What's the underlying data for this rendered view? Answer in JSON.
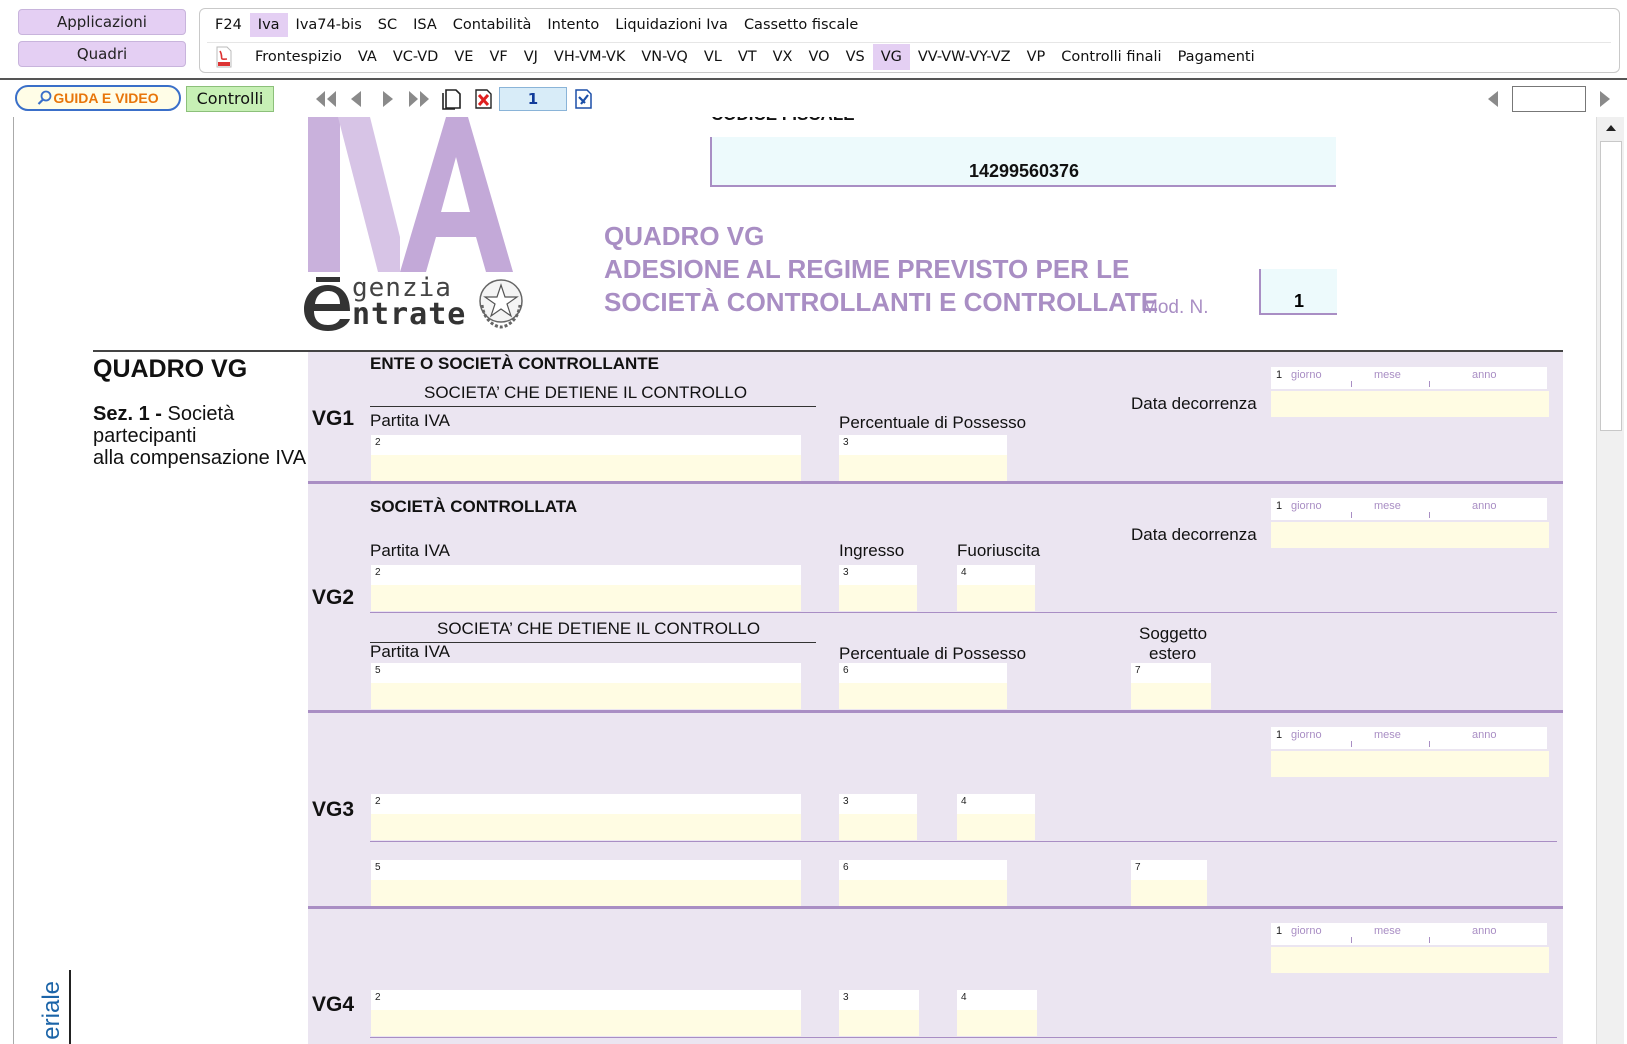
{
  "left_nav": {
    "applicazioni": "Applicazioni",
    "quadri": "Quadri"
  },
  "menu_row1": [
    "F24",
    "Iva",
    "Iva74-bis",
    "SC",
    "ISA",
    "Contabilità",
    "Intento",
    "Liquidazioni Iva",
    "Cassetto fiscale"
  ],
  "menu_row1_active": "Iva",
  "menu_row2": [
    "Frontespizio",
    "VA",
    "VC-VD",
    "VE",
    "VF",
    "VJ",
    "VH-VM-VK",
    "VN-VQ",
    "VL",
    "VT",
    "VX",
    "VO",
    "VS",
    "VG",
    "VV-VW-VY-VZ",
    "VP",
    "Controlli finali",
    "Pagamenti"
  ],
  "menu_row2_active": "VG",
  "toolbar": {
    "guida": "GUIDA E VIDEO",
    "controlli": "Controlli",
    "page_number": "1",
    "right_value": ""
  },
  "doc": {
    "codice_fiscale_label": "CODICE FISCALE",
    "codice_fiscale": "14299560376",
    "logo_agenzia_1": "genzia",
    "logo_agenzia_2": "ntrate",
    "title_1": "QUADRO VG",
    "title_2": "ADESIONE AL REGIME PREVISTO PER LE",
    "title_3": "SOCIETÀ CONTROLLANTI E CONTROLLATE",
    "mod_label": "Mod. N.",
    "mod_value": "1",
    "side_title": "QUADRO VG",
    "side_sez_bold": "Sez. 1 -",
    "side_sez_1": " Società",
    "side_sez_2": "partecipanti",
    "side_sez_3": "alla compensazione IVA",
    "side_vertical": "eriale",
    "date_labels": {
      "num": "1",
      "giorno": "giorno",
      "mese": "mese",
      "anno": "anno"
    },
    "vg1": {
      "code": "VG1",
      "header": "ENTE O SOCIETÀ CONTROLLANTE",
      "sub": "SOCIETA’ CHE DETIENE IL CONTROLLO",
      "partita_iva": "Partita IVA",
      "percentuale": "Percentuale di Possesso",
      "data_decorrenza": "Data decorrenza",
      "n2": "2",
      "n3": "3"
    },
    "vg2": {
      "code": "VG2",
      "header": "SOCIETÀ CONTROLLATA",
      "partita_iva": "Partita IVA",
      "ingresso": "Ingresso",
      "fuoriuscita": "Fuoriuscita",
      "data_decorrenza": "Data decorrenza",
      "sub": "SOCIETA’ CHE DETIENE IL CONTROLLO",
      "partita_iva_2": "Partita IVA",
      "percentuale": "Percentuale di Possesso",
      "soggetto_1": "Soggetto",
      "soggetto_2": "estero",
      "n2": "2",
      "n3": "3",
      "n4": "4",
      "n5": "5",
      "n6": "6",
      "n7": "7"
    },
    "vg3": {
      "code": "VG3",
      "n2": "2",
      "n3": "3",
      "n4": "4",
      "n5": "5",
      "n6": "6",
      "n7": "7"
    },
    "vg4": {
      "code": "VG4",
      "n2": "2",
      "n3": "3",
      "n4": "4"
    }
  }
}
